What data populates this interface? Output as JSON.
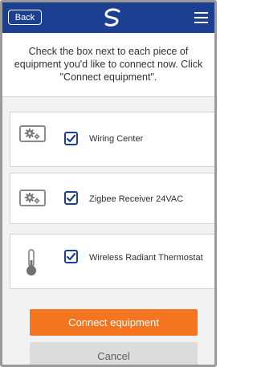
{
  "header": {
    "back_label": "Back",
    "logo_icon": "brand-swirl-icon",
    "menu_icon": "hamburger-menu-icon",
    "background": "#1d3f92"
  },
  "instruction": "Check the box next to each piece of equipment you'd like to connect now. Click \"Connect equipment\".",
  "equipment": [
    {
      "label": "Wiring Center",
      "icon": "gears-icon",
      "checked": true
    },
    {
      "label": "Zigbee Receiver 24VAC",
      "icon": "gears-icon",
      "checked": true
    },
    {
      "label": "Wireless Radiant Thermostat",
      "icon": "thermometer-icon",
      "checked": true
    }
  ],
  "actions": {
    "connect_label": "Connect equipment",
    "cancel_label": "Cancel",
    "connect_color": "#f47520",
    "cancel_color": "#dcdcdc"
  }
}
